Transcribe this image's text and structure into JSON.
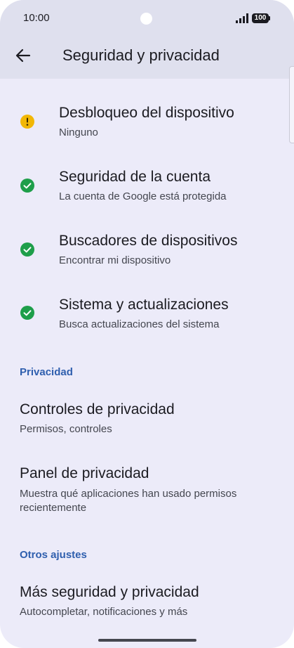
{
  "status_bar": {
    "time": "10:00",
    "battery": "100",
    "icons": [
      "signal-icon",
      "battery-icon"
    ]
  },
  "header": {
    "back_icon": "arrow-back-icon",
    "title": "Seguridad y privacidad"
  },
  "status_items": [
    {
      "title": "Desbloqueo del dispositivo",
      "subtitle": "Ninguno",
      "status": "warning",
      "icon": "warning-icon",
      "color": "#f2b705"
    },
    {
      "title": "Seguridad de la cuenta",
      "subtitle": "La cuenta de Google está protegida",
      "status": "ok",
      "icon": "check-icon",
      "color": "#1e9e4a"
    },
    {
      "title": "Buscadores de dispositivos",
      "subtitle": "Encontrar mi dispositivo",
      "status": "ok",
      "icon": "check-icon",
      "color": "#1e9e4a"
    },
    {
      "title": "Sistema y actualizaciones",
      "subtitle": "Busca actualizaciones del sistema",
      "status": "ok",
      "icon": "check-icon",
      "color": "#1e9e4a"
    }
  ],
  "privacy_section": {
    "header": "Privacidad",
    "items": [
      {
        "title": "Controles de privacidad",
        "subtitle": "Permisos, controles"
      },
      {
        "title": "Panel de privacidad",
        "subtitle": "Muestra qué aplicaciones han usado permisos recientemente"
      }
    ]
  },
  "other_section": {
    "header": "Otros ajustes",
    "items": [
      {
        "title": "Más seguridad y privacidad",
        "subtitle": "Autocompletar, notificaciones y más"
      }
    ]
  },
  "colors": {
    "accent": "#2f5fae",
    "background": "#ecebf9",
    "header_background": "#dfe0ee",
    "warning": "#f2b705",
    "ok": "#1e9e4a"
  }
}
